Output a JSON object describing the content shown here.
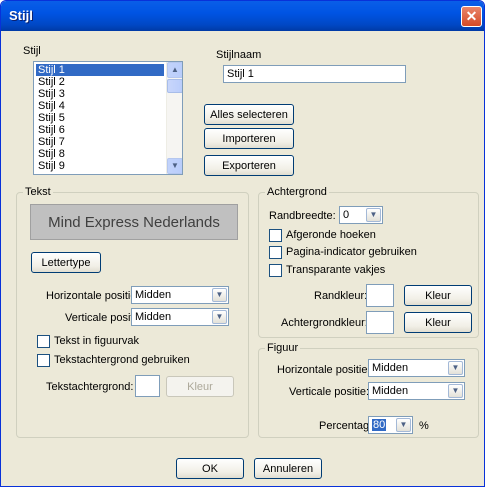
{
  "window": {
    "title": "Stijl",
    "close_glyph": "✕"
  },
  "stijl": {
    "label": "Stijl",
    "items": [
      "Stijl 1",
      "Stijl 2",
      "Stijl 3",
      "Stijl 4",
      "Stijl 5",
      "Stijl 6",
      "Stijl 7",
      "Stijl 8",
      "Stijl 9"
    ],
    "selected": "Stijl 1"
  },
  "stijlnaam": {
    "label": "Stijlnaam",
    "value": "Stijl 1"
  },
  "buttons": {
    "select_all": "Alles selecteren",
    "import": "Importeren",
    "export": "Exporteren",
    "font": "Lettertype",
    "ok": "OK",
    "cancel": "Annuleren"
  },
  "tekst": {
    "title": "Tekst",
    "preview_text": "Mind Express Nederlands",
    "hpos_label": "Horizontale positie:",
    "hpos_value": "Midden",
    "vpos_label": "Verticale positie:",
    "vpos_value": "Midden",
    "chk_figuurvak": "Tekst in figuurvak",
    "chk_tekstachtergrond": "Tekstachtergrond gebruiken",
    "bg_label": "Tekstachtergrond:",
    "bg_button": "Kleur"
  },
  "achtergrond": {
    "title": "Achtergrond",
    "randbreedte_label": "Randbreedte:",
    "randbreedte_value": "0",
    "chk_hoeken": "Afgeronde hoeken",
    "chk_pagina": "Pagina-indicator gebruiken",
    "chk_transparant": "Transparante vakjes",
    "randkleur_label": "Randkleur:",
    "randkleur_button": "Kleur",
    "achtergrondkleur_label": "Achtergrondkleur:",
    "achtergrondkleur_button": "Kleur"
  },
  "figuur": {
    "title": "Figuur",
    "hpos_label": "Horizontale positie:",
    "hpos_value": "Midden",
    "vpos_label": "Verticale positie:",
    "vpos_value": "Midden",
    "percentage_label": "Percentage:",
    "percentage_value": "80",
    "percentage_unit": "%"
  }
}
